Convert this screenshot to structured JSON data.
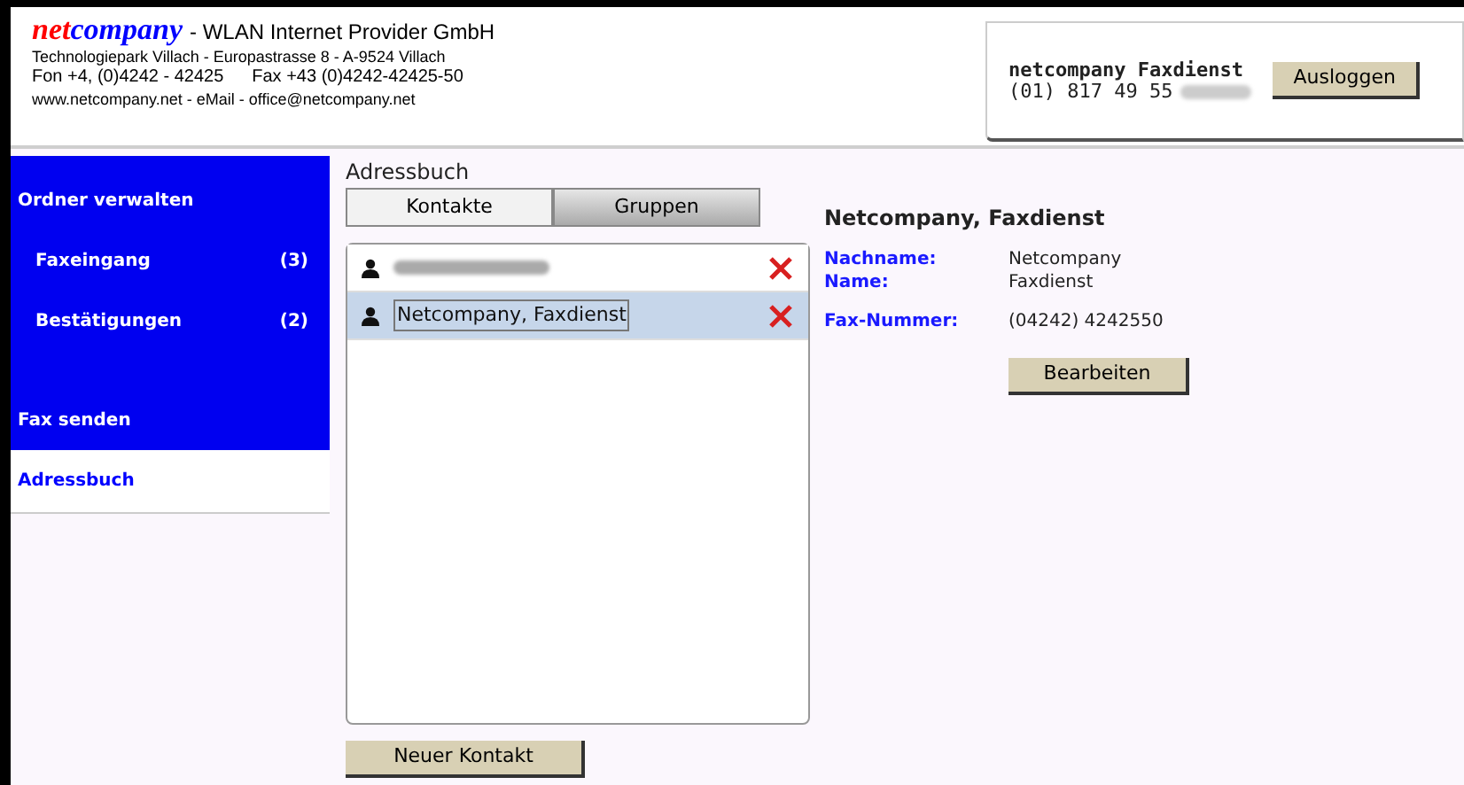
{
  "header": {
    "brand_part_1": "net",
    "brand_part_2": "company",
    "tagline": "- WLAN Internet Provider GmbH",
    "address": "Technologiepark Villach - Europastrasse 8 - A-9524 Villach",
    "phone": "Fon +4, (0)4242 - 42425",
    "fax": "Fax +43 (0)4242-42425-50",
    "web": "www.netcompany.net - eMail - office@netcompany.net"
  },
  "account": {
    "name": "netcompany Faxdienst",
    "number": "(01) 817 49 55",
    "number_redacted": true,
    "logout": "Ausloggen"
  },
  "sidebar": [
    {
      "kind": "group",
      "label": "Ordner verwalten",
      "selected": false
    },
    {
      "kind": "item",
      "label": "Faxeingang",
      "count": "(3)",
      "selected": false
    },
    {
      "kind": "item",
      "label": "Bestätigungen",
      "count": "(2)",
      "selected": false
    },
    {
      "kind": "group",
      "label": "Fax senden",
      "selected": false
    },
    {
      "kind": "group",
      "label": "Adressbuch",
      "selected": true
    }
  ],
  "title": "Adressbuch",
  "tabs": [
    {
      "label": "Kontakte",
      "selected": true
    },
    {
      "label": "Gruppen",
      "selected": false
    }
  ],
  "contacts": [
    {
      "redacted": true,
      "selected": false
    },
    {
      "name": "Netcompany, Faxdienst",
      "redacted": false,
      "selected": true
    }
  ],
  "new_contact": "Neuer Kontakt",
  "detail": {
    "title": "Netcompany, Faxdienst",
    "fields": [
      {
        "label": "Nachname:",
        "value": "Netcompany"
      },
      {
        "label": "Name:",
        "value": "Faxdienst"
      },
      {
        "label": "Fax-Nummer:",
        "value": "(04242) 4242550"
      }
    ],
    "edit": "Bearbeiten"
  }
}
